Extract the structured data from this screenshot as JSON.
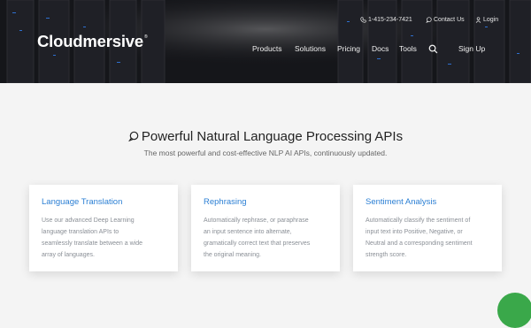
{
  "header": {
    "logo_text": "Cloudmersive",
    "logo_mark": "®",
    "phone": "1-415-234-7421",
    "contact_label": "Contact Us",
    "login_label": "Login",
    "nav": {
      "products": "Products",
      "solutions": "Solutions",
      "pricing": "Pricing",
      "docs": "Docs",
      "tools": "Tools",
      "signup": "Sign Up"
    }
  },
  "main": {
    "title": "Powerful Natural Language Processing APIs",
    "subtitle": "The most powerful and cost-effective NLP AI APIs, continuously updated."
  },
  "cards": [
    {
      "title": "Language Translation",
      "lines": [
        "Use our advanced Deep Learning",
        "language translation APIs to",
        "seamlessly translate between a wide",
        "array of languages."
      ]
    },
    {
      "title": "Rephrasing",
      "lines": [
        "Automatically rephrase, or paraphrase",
        "an input sentence into alternate,",
        "gramatically correct text that preserves",
        "the original meaning."
      ]
    },
    {
      "title": "Sentiment Analysis",
      "lines": [
        "Automatically classify the sentiment of",
        "input text into Positive, Negative, or",
        "Neutral and a corresponding sentiment",
        "strength score."
      ]
    }
  ],
  "colors": {
    "header_bg": "#16161a",
    "accent": "#2b7fd4",
    "page_bg": "#f4f4f4",
    "help_bubble": "#3aa84a"
  }
}
